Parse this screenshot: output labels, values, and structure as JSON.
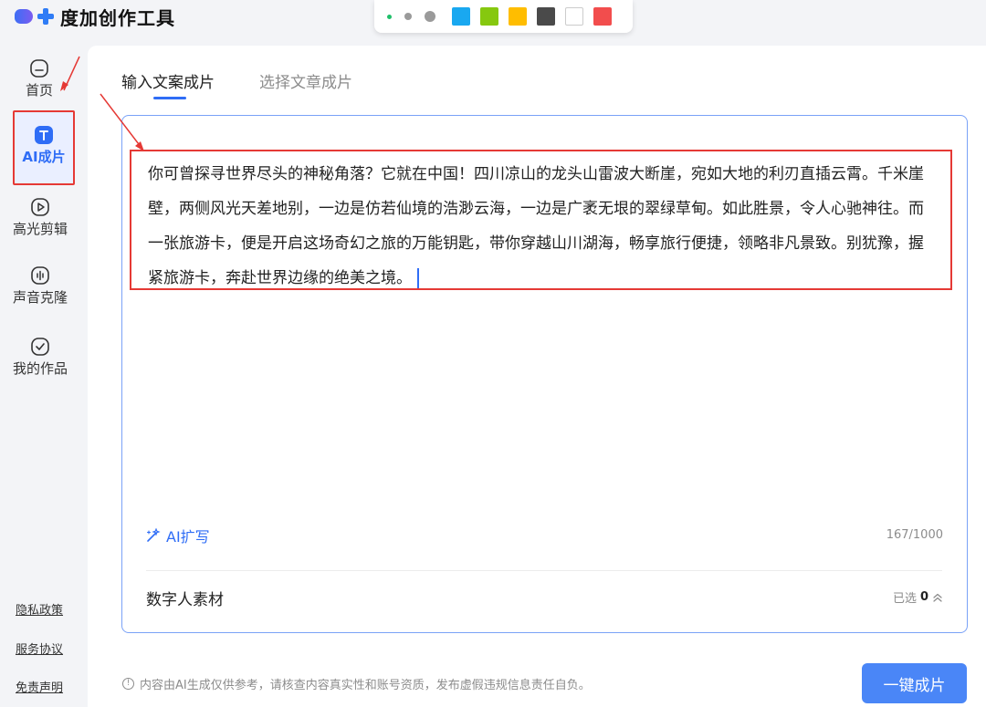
{
  "app": {
    "title": "度加创作工具"
  },
  "palette": {
    "swatches": [
      "#19a8f0",
      "#86c80f",
      "#ffbd00",
      "#4a4a4a",
      "#ffffff",
      "#f24d4d"
    ]
  },
  "sidebar": {
    "items": [
      {
        "label": "首页",
        "icon": "home-icon"
      },
      {
        "label": "AI成片",
        "icon": "text-t-icon",
        "active": true
      },
      {
        "label": "高光剪辑",
        "icon": "play-icon"
      },
      {
        "label": "声音克隆",
        "icon": "voice-icon"
      },
      {
        "label": "我的作品",
        "icon": "check-box-icon"
      }
    ],
    "footer_links": [
      "隐私政策",
      "服务协议",
      "免责声明"
    ]
  },
  "tabs": [
    {
      "label": "输入文案成片",
      "active": true
    },
    {
      "label": "选择文章成片",
      "active": false
    }
  ],
  "editor": {
    "text": "你可曾探寻世界尽头的神秘角落？它就在中国！四川凉山的龙头山雷波大断崖，宛如大地的利刃直插云霄。千米崖壁，两侧风光天差地别，一边是仿若仙境的浩渺云海，一边是广袤无垠的翠绿草甸。如此胜景，令人心驰神往。而一张旅游卡，便是开启这场奇幻之旅的万能钥匙，带你穿越山川湖海，畅享旅行便捷，领略非凡景致。别犹豫，握紧旅游卡，奔赴世界边缘的绝美之境。",
    "ai_expand_label": "AI扩写",
    "char_count": "167/1000",
    "digital_human_label": "数字人素材",
    "selected_prefix": "已选",
    "selected_count": "0"
  },
  "footer": {
    "disclaimer": "内容由AI生成仅供参考，请核查内容真实性和账号资质，发布虚假违规信息责任自负。",
    "button_label": "一键成片"
  },
  "colors": {
    "accent": "#2f6df6",
    "annotation_red": "#e53935"
  }
}
